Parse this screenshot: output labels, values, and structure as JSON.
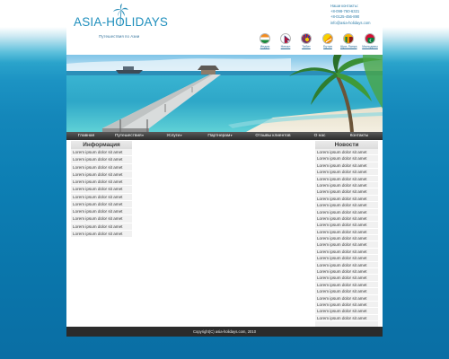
{
  "header": {
    "logo_text": "ASIA-HOLIDAYS",
    "tagline": "Путешествия по Азии",
    "contacts_title": "Наши контакты:",
    "phone_1": "+8-098-760-6321",
    "phone_2": "+8-0125-456-890",
    "email": "info@asia-holidays.com"
  },
  "flags": [
    {
      "label": "Индия",
      "colors": [
        "#f28b1e",
        "#ffffff",
        "#1a8a3c"
      ]
    },
    {
      "label": "Непал",
      "colors": [
        "#c8102e",
        "#1c2e7a",
        "#ffffff"
      ]
    },
    {
      "label": "Тибет",
      "colors": [
        "#1f3f9a",
        "#d62828",
        "#f5d000"
      ]
    },
    {
      "label": "Бутан",
      "colors": [
        "#f7d000",
        "#f08a00",
        "#ffffff"
      ]
    },
    {
      "label": "Шри-Ланка",
      "colors": [
        "#f7b500",
        "#8d1b1b",
        "#00843d"
      ]
    },
    {
      "label": "Мальдивы",
      "colors": [
        "#d21034",
        "#007e3a",
        "#ffffff"
      ]
    }
  ],
  "nav": [
    {
      "label": "Главная",
      "dropdown": false
    },
    {
      "label": "Путешествия",
      "dropdown": true
    },
    {
      "label": "Услуги",
      "dropdown": true
    },
    {
      "label": "Партнерам",
      "dropdown": true
    },
    {
      "label": "Отзывы клиентов",
      "dropdown": false
    },
    {
      "label": "О нас",
      "dropdown": false
    },
    {
      "label": "Контакты",
      "dropdown": false
    }
  ],
  "nav_caret": "▾",
  "sidebar_left": {
    "title": "Информация",
    "items": [
      "Lorem ipsum dolor sit amet",
      "Lorem ipsum dolor sit amet",
      "Lorem ipsum dolor sit amet",
      "Lorem ipsum dolor sit amet",
      "Lorem ipsum dolor sit amet",
      "Lorem ipsum dolor sit amet",
      "Lorem ipsum dolor sit amet",
      "Lorem ipsum dolor sit amet",
      "Lorem ipsum dolor sit amet",
      "Lorem ipsum dolor sit amet",
      "Lorem ipsum dolor sit amet",
      "Lorem ipsum dolor sit amet"
    ]
  },
  "sidebar_right": {
    "title": "Новости",
    "items": [
      "Lorem ipsum dolor sit amet",
      "Lorem ipsum dolor sit amet",
      "Lorem ipsum dolor sit amet",
      "Lorem ipsum dolor sit amet",
      "Lorem ipsum dolor sit amet",
      "Lorem ipsum dolor sit amet",
      "Lorem ipsum dolor sit amet",
      "Lorem ipsum dolor sit amet",
      "Lorem ipsum dolor sit amet",
      "Lorem ipsum dolor sit amet",
      "Lorem ipsum dolor sit amet",
      "Lorem ipsum dolor sit amet",
      "Lorem ipsum dolor sit amet",
      "Lorem ipsum dolor sit amet",
      "Lorem ipsum dolor sit amet",
      "Lorem ipsum dolor sit amet",
      "Lorem ipsum dolor sit amet",
      "Lorem ipsum dolor sit amet",
      "Lorem ipsum dolor sit amet",
      "Lorem ipsum dolor sit amet",
      "Lorem ipsum dolor sit amet",
      "Lorem ipsum dolor sit amet",
      "Lorem ipsum dolor sit amet",
      "Lorem ipsum dolor sit amet",
      "Lorem ipsum dolor sit amet",
      "Lorem ipsum dolor sit amet"
    ]
  },
  "footer": {
    "copyright": "Copyright(C) asia-holidays.com, 2010"
  },
  "colors": {
    "brand_blue": "#1f8fbd",
    "nav_bg": "#333333",
    "page_bg_blue": "#0d7fb4"
  }
}
